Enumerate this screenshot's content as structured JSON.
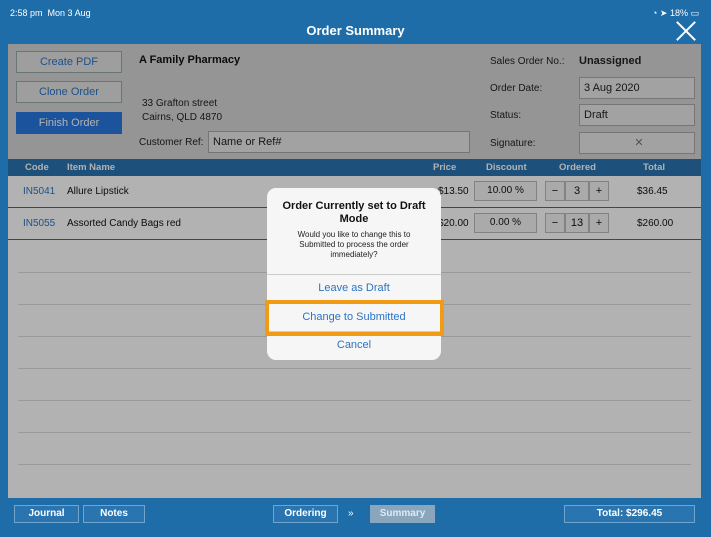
{
  "statusbar": {
    "time": "2:58 pm",
    "date": "Mon 3 Aug",
    "battery": "18%"
  },
  "title": "Order Summary",
  "buttons": {
    "create_pdf": "Create PDF",
    "clone_order": "Clone Order",
    "finish_order": "Finish Order"
  },
  "customer": {
    "name": "A Family Pharmacy",
    "address_line1": "33 Grafton street",
    "address_line2": "Cairns, QLD 4870"
  },
  "customer_ref": {
    "label": "Customer Ref:",
    "placeholder": "Name or Ref#"
  },
  "order_info": {
    "sales_order_label": "Sales Order No.:",
    "sales_order_value": "Unassigned",
    "order_date_label": "Order Date:",
    "order_date_value": "3 Aug 2020",
    "status_label": "Status:",
    "status_value": "Draft",
    "signature_label": "Signature:"
  },
  "table": {
    "columns": {
      "code": "Code",
      "item_name": "Item Name",
      "price": "Price",
      "discount": "Discount",
      "ordered": "Ordered",
      "total": "Total"
    },
    "rows": [
      {
        "code": "IN5041",
        "item_name": "Allure Lipstick",
        "price": "$13.50",
        "discount": "10.00 %",
        "qty": "3",
        "total": "$36.45"
      },
      {
        "code": "IN5055",
        "item_name": "Assorted Candy Bags red",
        "price": "$20.00",
        "discount": "0.00 %",
        "qty": "13",
        "total": "$260.00"
      }
    ],
    "minus": "−",
    "plus": "+"
  },
  "footer": {
    "journal": "Journal",
    "notes": "Notes",
    "ordering": "Ordering",
    "arrows": "»",
    "summary": "Summary",
    "total": "Total: $296.45"
  },
  "dialog": {
    "title": "Order Currently set to Draft Mode",
    "message": "Would you like to change this to Submitted to process the order immediately?",
    "leave_draft": "Leave as Draft",
    "change_submitted": "Change to Submitted",
    "cancel": "Cancel"
  },
  "colors": {
    "brand_blue": "#1e6da8",
    "link_blue": "#2b74c6",
    "highlight": "#f19a14"
  }
}
